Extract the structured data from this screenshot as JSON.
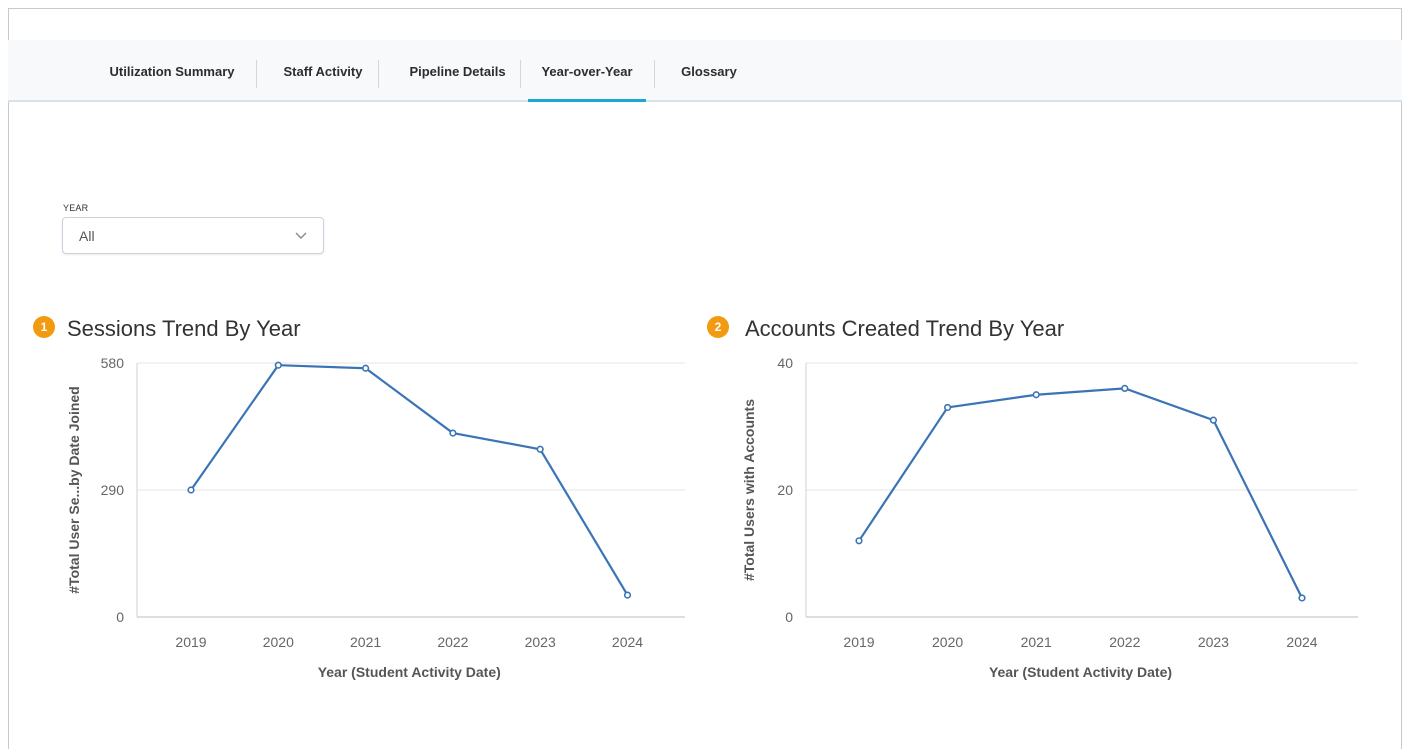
{
  "tabs": [
    {
      "label": "Utilization Summary",
      "active": false
    },
    {
      "label": "Staff Activity",
      "active": false
    },
    {
      "label": "Pipeline Details",
      "active": false
    },
    {
      "label": "Year-over-Year",
      "active": true
    },
    {
      "label": "Glossary",
      "active": false
    }
  ],
  "filter": {
    "label": "YEAR",
    "value": "All",
    "icon": "chevron-down-icon"
  },
  "charts": {
    "sessions": {
      "badge": "1",
      "title": "Sessions Trend By Year"
    },
    "accounts": {
      "badge": "2",
      "title": "Accounts Created Trend By Year"
    }
  },
  "colors": {
    "accent": "#1ba6d6",
    "line": "#3a74b6",
    "badge": "#f29a10"
  },
  "chart_data": [
    {
      "type": "line",
      "title": "Sessions Trend By Year",
      "xlabel": "Year (Student Activity Date)",
      "ylabel": "#Total User Se...by Date Joined",
      "categories": [
        "2019",
        "2020",
        "2021",
        "2022",
        "2023",
        "2024"
      ],
      "values": [
        290,
        575,
        568,
        420,
        383,
        50
      ],
      "ylim": [
        0,
        580
      ],
      "yticks": [
        "0",
        "290",
        "580"
      ],
      "grid": true
    },
    {
      "type": "line",
      "title": "Accounts Created Trend By Year",
      "xlabel": "Year (Student Activity Date)",
      "ylabel": "#Total Users with Accounts",
      "categories": [
        "2019",
        "2020",
        "2021",
        "2022",
        "2023",
        "2024"
      ],
      "values": [
        12,
        33,
        35,
        36,
        31,
        3
      ],
      "ylim": [
        0,
        40
      ],
      "yticks": [
        "0",
        "20",
        "40"
      ],
      "grid": true
    }
  ]
}
